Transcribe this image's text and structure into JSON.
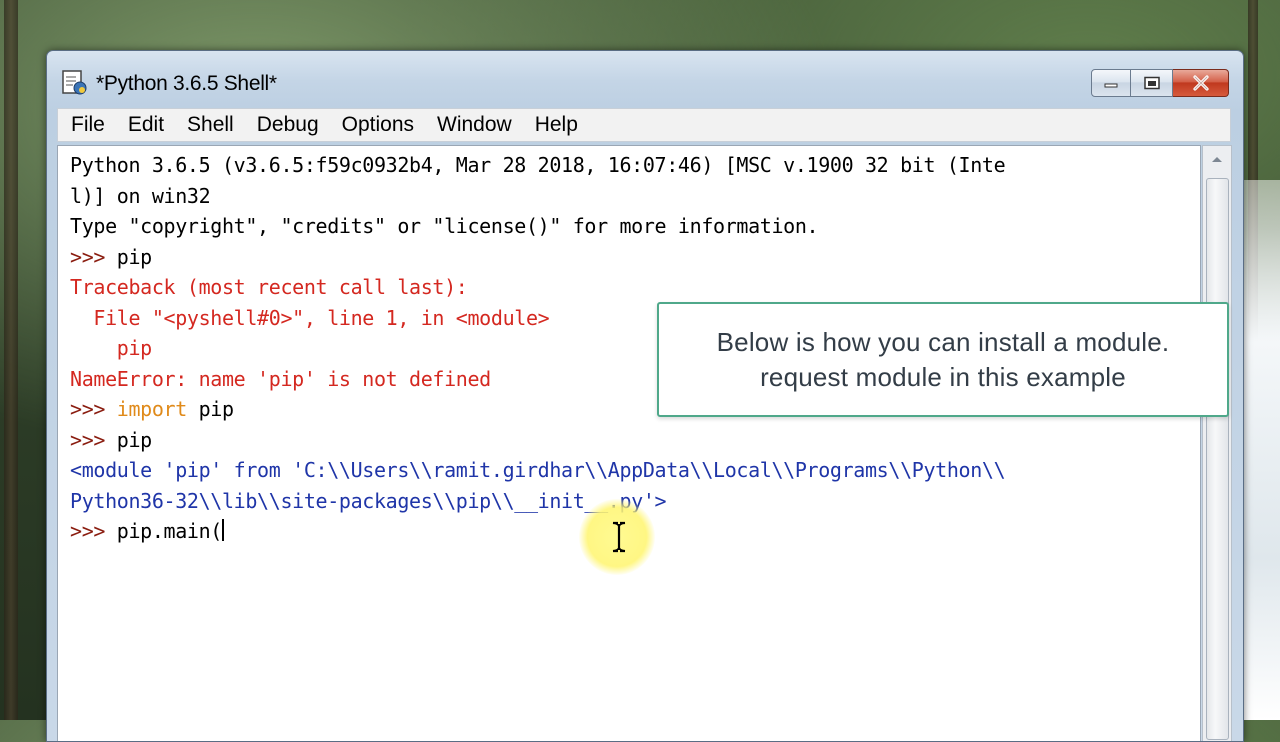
{
  "window": {
    "title": "*Python 3.6.5 Shell*"
  },
  "menu": [
    {
      "label": "File"
    },
    {
      "label": "Edit"
    },
    {
      "label": "Shell"
    },
    {
      "label": "Debug"
    },
    {
      "label": "Options"
    },
    {
      "label": "Window"
    },
    {
      "label": "Help"
    }
  ],
  "shell": {
    "banner_1": "Python 3.6.5 (v3.6.5:f59c0932b4, Mar 28 2018, 16:07:46) [MSC v.1900 32 bit (Inte",
    "banner_2": "l)] on win32",
    "banner_3": "Type \"copyright\", \"credits\" or \"license()\" for more information.",
    "prompt": ">>> ",
    "cmd_1": "pip",
    "error_1": "Traceback (most recent call last):",
    "error_2": "  File \"<pyshell#0>\", line 1, in <module>",
    "error_3": "    pip",
    "error_4": "NameError: name 'pip' is not defined",
    "cmd_2_keyword": "import",
    "cmd_2_rest": " pip",
    "cmd_3": "pip",
    "result_1": "<module 'pip' from 'C:\\\\Users\\\\ramit.girdhar\\\\AppData\\\\Local\\\\Programs\\\\Python\\\\",
    "result_2": "Python36-32\\\\lib\\\\site-packages\\\\pip\\\\__init__.py'>",
    "cmd_4": "pip.main("
  },
  "callout": {
    "line_1": "Below is how you can install a module.",
    "line_2": "request module in this example"
  },
  "colors": {
    "prompt": "#8a1c0f",
    "error": "#d42820",
    "keyword": "#e08a1a",
    "result": "#1f35a8",
    "callout_border": "#4fa88a"
  },
  "icons": {
    "app": "python-idle-icon",
    "minimize": "minimize-icon",
    "maximize": "maximize-icon",
    "close": "close-icon",
    "scroll_up": "chevron-up-icon",
    "mouse": "ibeam-cursor-icon"
  }
}
